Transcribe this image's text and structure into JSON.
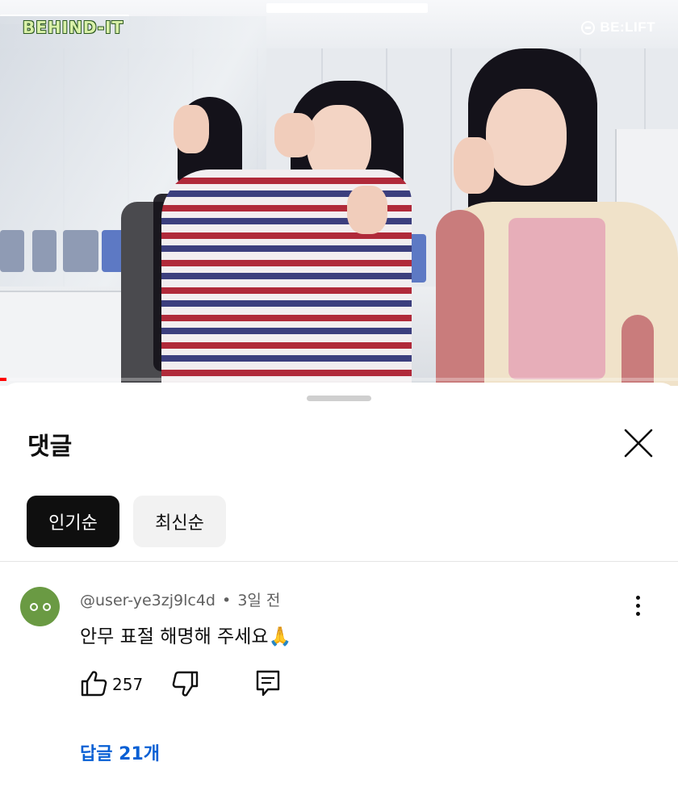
{
  "video": {
    "channel_logo_left": "BEHIND-IT",
    "channel_logo_right": "BE:LIFT",
    "progress_fraction": 0.01
  },
  "comments_panel": {
    "title": "댓글",
    "sort_tabs": [
      {
        "label": "인기순",
        "active": true
      },
      {
        "label": "최신순",
        "active": false
      }
    ],
    "comments": [
      {
        "author": "@user-ye3zj9lc4d",
        "separator": "•",
        "time": "3일 전",
        "text": "안무 표절 해명해 주세요🙏",
        "likes": "257",
        "replies_label": "답글 21개",
        "avatar_color": "#6a9a43"
      }
    ]
  },
  "icons": {
    "close": "close-icon",
    "more": "more-vert-icon",
    "like": "thumb-up-icon",
    "dislike": "thumb-down-icon",
    "reply": "reply-icon"
  },
  "colors": {
    "link": "#065fd4",
    "active_chip": "#0f0f0f",
    "inactive_chip": "#f2f2f2",
    "progress": "#ff0000"
  }
}
